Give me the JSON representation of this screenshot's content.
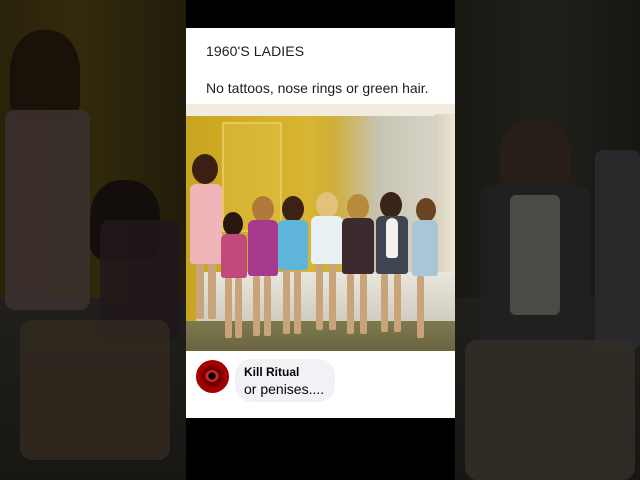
{
  "post": {
    "title": "1960'S LADIES",
    "subtitle": "No tattoos, nose rings or green hair."
  },
  "comment": {
    "author": "Kill Ritual",
    "text": "or penises...."
  },
  "colors": {
    "card_background": "#ffffff",
    "bubble_background": "#f0f2f5",
    "page_background": "#000000",
    "photo_wall": "#d8b532"
  },
  "icons": {
    "avatar": "red-eye-avatar"
  }
}
